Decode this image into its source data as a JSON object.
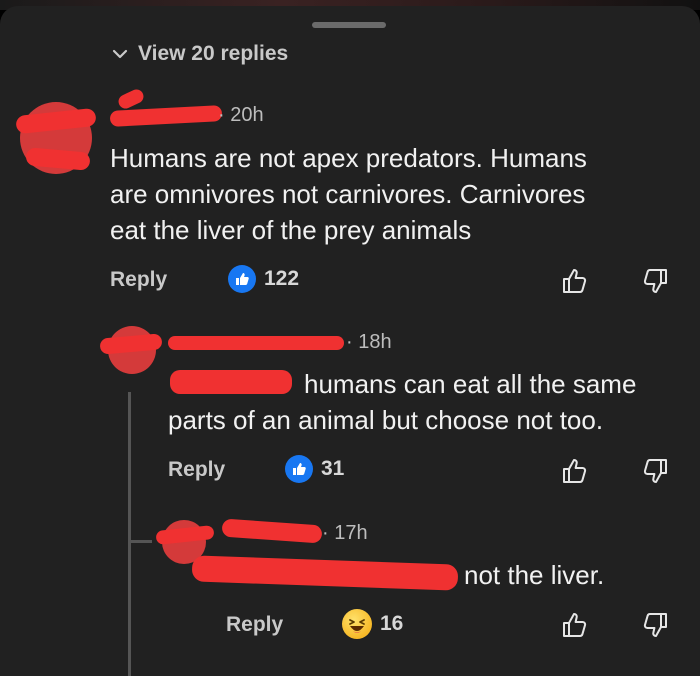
{
  "sheet": {
    "view_replies_label": "View 20 replies"
  },
  "comments": [
    {
      "time": "20h",
      "text_lines": [
        "Humans are not apex predators. Humans",
        "are omnivores not carnivores.  Carnivores",
        "eat the liver of the prey animals"
      ],
      "reply_label": "Reply",
      "reaction": "like",
      "reaction_count": "122"
    },
    {
      "time": "18h",
      "text_lines": [
        "humans can eat all the same",
        "parts of an animal but  choose not too."
      ],
      "reply_label": "Reply",
      "reaction": "like",
      "reaction_count": "31"
    },
    {
      "time": "17h",
      "text_lines": [
        "not the liver."
      ],
      "reply_label": "Reply",
      "reaction": "haha",
      "reaction_count": "16"
    }
  ],
  "colors": {
    "background": "#212121",
    "redaction": "#f03131",
    "like_blue": "#1877f2",
    "text": "#f1f1f1",
    "muted": "#bdbdbd"
  },
  "icons": [
    "chevron-down-icon",
    "like-reaction-icon",
    "haha-reaction-icon",
    "thumbs-up-icon",
    "thumbs-down-icon"
  ]
}
